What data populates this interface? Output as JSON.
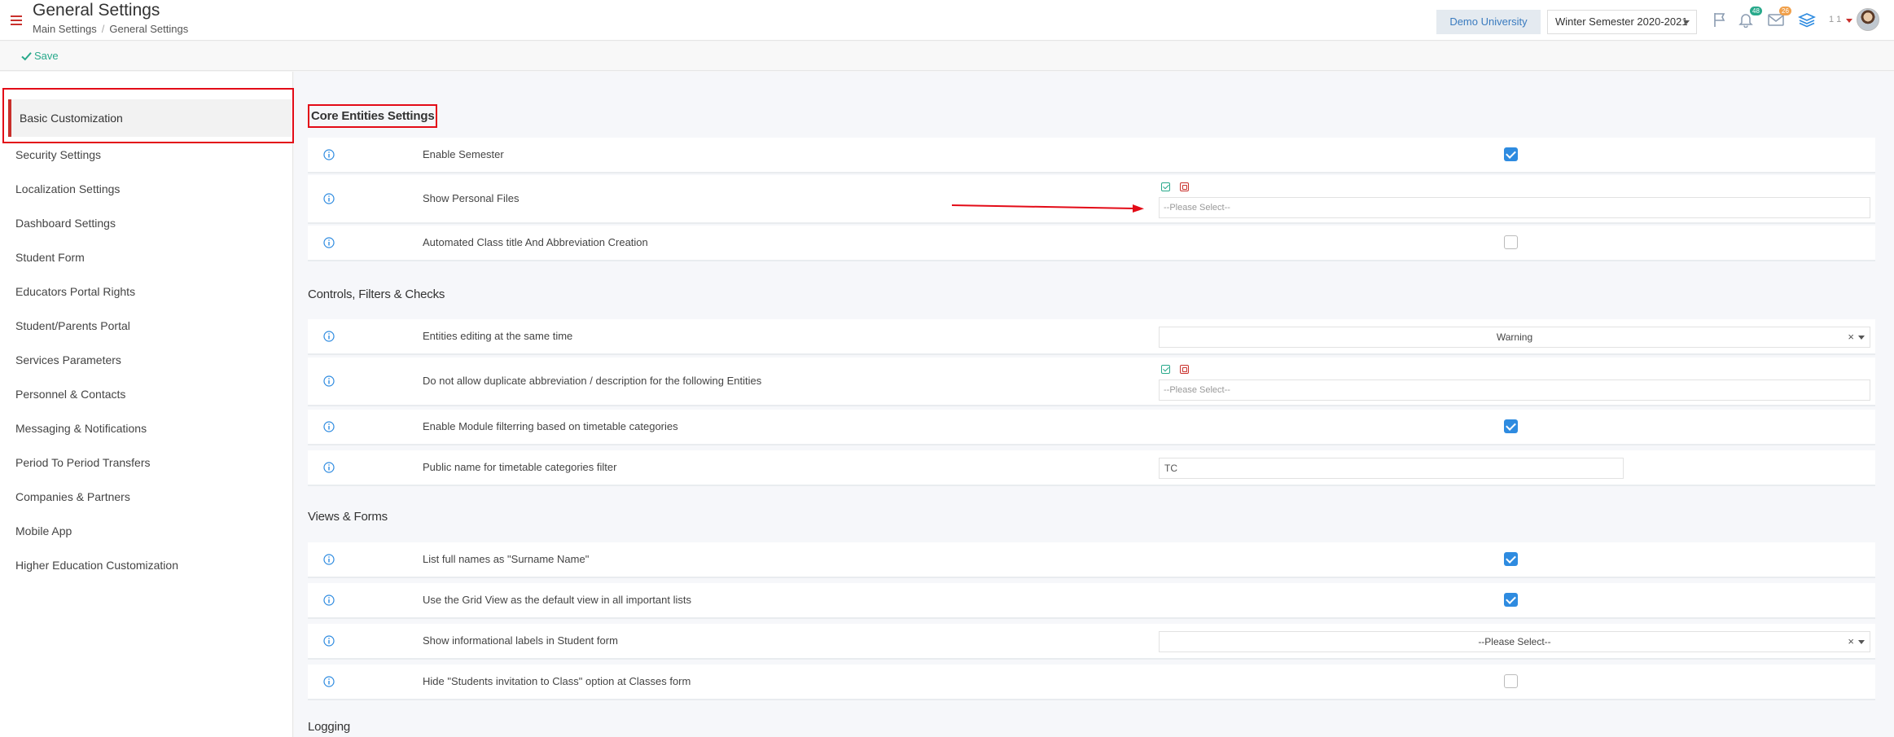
{
  "header": {
    "title": "General Settings",
    "breadcrumb": [
      "Main Settings",
      "General Settings"
    ],
    "breadcrumb_separator": "/",
    "organization": "Demo University",
    "semester": "Winter Semester 2020-2021",
    "notifications_count": "48",
    "messages_count": "26",
    "user_indicator": "1 1"
  },
  "toolbar": {
    "save_label": "Save"
  },
  "sidebar": {
    "items": [
      {
        "label": "Basic Customization",
        "active": true
      },
      {
        "label": "Security Settings"
      },
      {
        "label": "Localization Settings"
      },
      {
        "label": "Dashboard Settings"
      },
      {
        "label": "Student Form"
      },
      {
        "label": "Educators Portal Rights"
      },
      {
        "label": "Student/Parents Portal"
      },
      {
        "label": "Services Parameters"
      },
      {
        "label": "Personnel & Contacts"
      },
      {
        "label": "Messaging & Notifications"
      },
      {
        "label": "Period To Period Transfers"
      },
      {
        "label": "Companies & Partners"
      },
      {
        "label": "Mobile App"
      },
      {
        "label": "Higher Education Customization"
      }
    ]
  },
  "sections": {
    "core": {
      "title": "Core Entities Settings",
      "rows": [
        {
          "label": "Enable Semester",
          "type": "checkbox",
          "checked": true
        },
        {
          "label": "Show Personal Files",
          "type": "multiselect",
          "placeholder": "--Please Select--"
        },
        {
          "label": "Automated Class title And Abbreviation Creation",
          "type": "checkbox",
          "checked": false
        }
      ]
    },
    "controls": {
      "title": "Controls, Filters & Checks",
      "rows": [
        {
          "label": "Entities editing at the same time",
          "type": "select",
          "value": "Warning",
          "clear": "×"
        },
        {
          "label": "Do not allow duplicate abbreviation / description for the following Entities",
          "type": "multiselect",
          "placeholder": "--Please Select--"
        },
        {
          "label": "Enable Module filterring based on timetable categories",
          "type": "checkbox",
          "checked": true
        },
        {
          "label": "Public name for timetable categories filter",
          "type": "text",
          "value": "TC"
        }
      ]
    },
    "views": {
      "title": "Views & Forms",
      "rows": [
        {
          "label": "List full names as \"Surname Name\"",
          "type": "checkbox",
          "checked": true
        },
        {
          "label": "Use the Grid View as the default view in all important lists",
          "type": "checkbox",
          "checked": true
        },
        {
          "label": "Show informational labels in Student form",
          "type": "select",
          "value": "--Please Select--",
          "clear": "×"
        },
        {
          "label": "Hide \"Students invitation to Class\" option at Classes form",
          "type": "checkbox",
          "checked": false
        }
      ]
    },
    "logging": {
      "title": "Logging"
    }
  },
  "colors": {
    "accent_red": "#c9302c",
    "annotation_red": "#e30b17",
    "checkbox_blue": "#2e8be0",
    "save_green": "#28a98b",
    "badge_green": "#28a98b",
    "badge_orange": "#f0a04b"
  },
  "icons": [
    "hamburger-icon",
    "flag-icon",
    "bell-icon",
    "envelope-icon",
    "layers-icon",
    "info-icon",
    "check-icon"
  ]
}
